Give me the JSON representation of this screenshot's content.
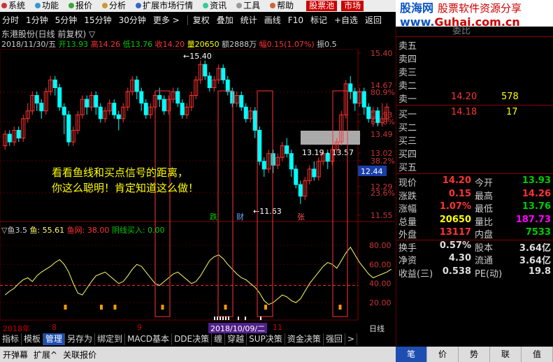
{
  "menu": {
    "items": [
      "系统",
      "功能",
      "报价",
      "分析",
      "扩展市场行情",
      "资讯",
      "工具",
      "帮助"
    ],
    "highlight1": "股票池",
    "highlight2": "市场"
  },
  "toolbar": {
    "periods": [
      "分时",
      "1分钟",
      "5分钟",
      "15分钟",
      "30分钟",
      "更多 >"
    ],
    "tools": [
      "复权",
      "叠加",
      "统计",
      "画线",
      "F10",
      "标记",
      "+自选",
      "返回"
    ]
  },
  "logo": {
    "line1": "股海网",
    "line1b": "股票软件资源分享",
    "line2a": "www.",
    "line2b": "Guhai.com.cn"
  },
  "chart_header": {
    "title": "东港股份(日线 前复权) ▽",
    "date": "2018/11/30/五",
    "open_label": "开",
    "open": "13.93",
    "high_label": "高",
    "high": "14.26",
    "low_label": "低",
    "low": "13.76",
    "close_label": "收",
    "close": "14.20",
    "vol_label": "量",
    "vol": "20650",
    "amt_label": "额",
    "amt": "2888万",
    "chg_label": "幅",
    "chg": "0.15(1.07%)",
    "amp_label": "振",
    "amp": "0.5"
  },
  "price_axis": [
    "15.40",
    "14.67",
    "80.9%",
    "13.93",
    "61.8%",
    "13.49",
    "13.02",
    "38.2%",
    "12.29",
    "23.6%",
    "11.55"
  ],
  "current_price_tag": "12.44",
  "price_annotations": {
    "high": "15.40",
    "low": "11.63",
    "range": "13.19 - 13.57"
  },
  "signal_labels": {
    "die": "跌",
    "cai": "财",
    "zhang": "张"
  },
  "annotation": [
    "看看鱼线和买点信号的距离，",
    "你这么聪明！肯定知道这么做！"
  ],
  "indicator": {
    "name": "▽鱼3.5",
    "fish": "鱼: 55.61",
    "fishnet": "鱼网: 38.00",
    "yang": "阴线买入: 0.00"
  },
  "indicator_axis": [
    "80.00",
    "60.00",
    "40.00",
    "20.00"
  ],
  "xaxis": {
    "year": "2018年",
    "m8": "8",
    "m9": "9",
    "m11": "11",
    "cursor_date": "2018/10/09/二",
    "period": "日线"
  },
  "bottom_tabs": [
    "指标",
    "模板",
    "管理",
    "另存为",
    "绑定到",
    "MACD基本",
    "DDE决策",
    "缠",
    "穿越",
    "SUP决策",
    "资金决策",
    "强回",
    ">"
  ],
  "bottom_active": "管理",
  "status": [
    "开弹幕",
    "扩展^",
    "关联报价"
  ],
  "right_tabs": [
    "笔",
    "价",
    "势",
    "联",
    "值"
  ],
  "right_active": "笔",
  "quote": {
    "sell_labels": [
      "卖五",
      "卖四",
      "卖三",
      "卖二",
      "卖一"
    ],
    "sell1_price": "14.20",
    "sell1_vol": "578",
    "buy_labels": [
      "买一",
      "买二",
      "买三",
      "买四",
      "买五"
    ],
    "buy1_price": "14.18",
    "buy1_vol": "17",
    "top_partial": "委比",
    "rows": [
      {
        "l1": "现价",
        "v1": "14.20",
        "l2": "今开",
        "v2": "13.93",
        "c1": "#f33",
        "c2": "#0c0"
      },
      {
        "l1": "涨跌",
        "v1": "0.15",
        "l2": "最高",
        "v2": "14.26",
        "c1": "#f33",
        "c2": "#f33"
      },
      {
        "l1": "涨幅",
        "v1": "1.07%",
        "l2": "最低",
        "v2": "13.76",
        "c1": "#f33",
        "c2": "#0c0"
      },
      {
        "l1": "总量",
        "v1": "20650",
        "l2": "量比",
        "v2": "187.73",
        "c1": "#ff0",
        "c2": "#f0f"
      },
      {
        "l1": "外盘",
        "v1": "13117",
        "l2": "内盘",
        "v2": "7533",
        "c1": "#f33",
        "c2": "#0c0"
      },
      {
        "l1": "换手",
        "v1": "0.57%",
        "l2": "股本",
        "v2": "3.64亿",
        "c1": "#ddd",
        "c2": "#ddd"
      },
      {
        "l1": "净资",
        "v1": "4.30",
        "l2": "流通",
        "v2": "3.64亿",
        "c1": "#ddd",
        "c2": "#ddd"
      },
      {
        "l1": "收益(三)",
        "v1": "0.538",
        "l2": "PE(动)",
        "v2": "19.8",
        "c1": "#ddd",
        "c2": "#ddd"
      }
    ]
  },
  "colors": {
    "up": "#ff3333",
    "down": "#00ffff",
    "fishline": "#ffff66",
    "bg": "#000000",
    "box": "#ff3333"
  }
}
